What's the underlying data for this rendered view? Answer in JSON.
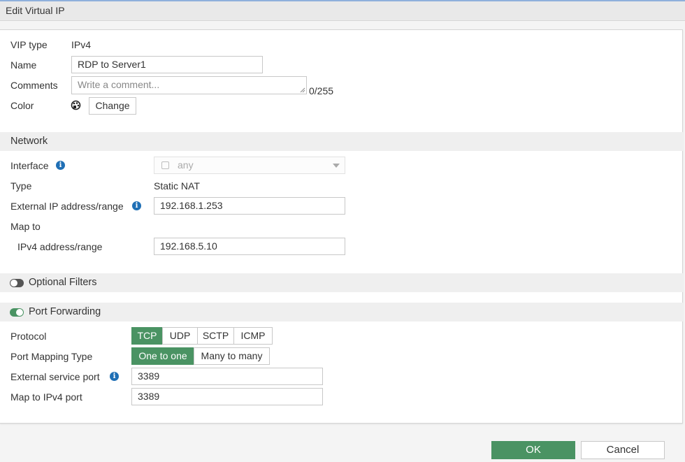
{
  "window": {
    "title": "Edit Virtual IP"
  },
  "general": {
    "vip_type_label": "VIP type",
    "vip_type_value": "IPv4",
    "name_label": "Name",
    "name_value": "RDP to Server1",
    "comments_label": "Comments",
    "comments_placeholder": "Write a comment...",
    "comments_counter": "0/255",
    "color_label": "Color",
    "color_change": "Change"
  },
  "network": {
    "header": "Network",
    "interface_label": "Interface",
    "interface_value": "any",
    "type_label": "Type",
    "type_value": "Static NAT",
    "external_ip_label": "External IP address/range",
    "external_ip_value": "192.168.1.253",
    "map_to_label": "Map to",
    "ipv4_range_label": "IPv4 address/range",
    "ipv4_range_value": "192.168.5.10"
  },
  "optional_filters": {
    "label": "Optional Filters",
    "enabled": false
  },
  "port_forwarding": {
    "label": "Port Forwarding",
    "enabled": true,
    "protocol_label": "Protocol",
    "protocols": [
      "TCP",
      "UDP",
      "SCTP",
      "ICMP"
    ],
    "protocol_selected": "TCP",
    "mapping_type_label": "Port Mapping Type",
    "mapping_types": [
      "One to one",
      "Many to many"
    ],
    "mapping_selected": "One to one",
    "external_port_label": "External service port",
    "external_port_value": "3389",
    "map_port_label": "Map to IPv4 port",
    "map_port_value": "3389"
  },
  "footer": {
    "ok": "OK",
    "cancel": "Cancel"
  },
  "colors": {
    "accent": "#4a9363",
    "info": "#1f6fb5",
    "section_bg": "#efefef"
  }
}
